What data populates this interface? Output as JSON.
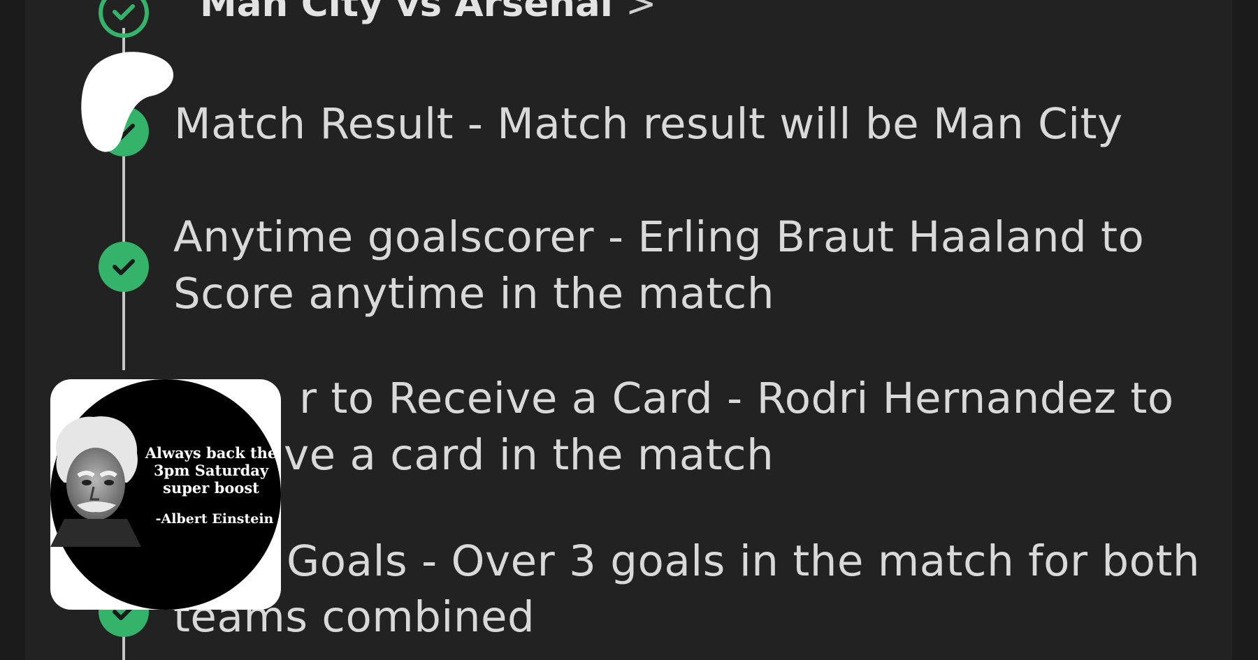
{
  "event": {
    "title": "Man City vs Arsenal",
    "chevron": ">"
  },
  "selections": [
    {
      "status": "won",
      "line1": "Match Result - Match result will be Man City",
      "line2": ""
    },
    {
      "status": "won",
      "line1": "Anytime goalscorer - Erling Braut Haaland to",
      "line2": "Score anytime in the match"
    },
    {
      "status": "won",
      "line1": "r to Receive a Card - Rodri Hernandez to",
      "line2": "ve a card in the match"
    },
    {
      "status": "won",
      "line1": "Goals - Over 3 goals in the match for both",
      "line2": "teams combined"
    }
  ],
  "sticker": {
    "quote": "Always back the 3pm Saturday super boost",
    "author": "-Albert Einstein"
  },
  "colors": {
    "background": "#1b1b1b",
    "card": "#222222",
    "accent_green": "#34b46a",
    "text": "#d9d9d9"
  },
  "icons": {
    "check": "check-circle-icon",
    "chevron": "chevron-right-icon"
  }
}
